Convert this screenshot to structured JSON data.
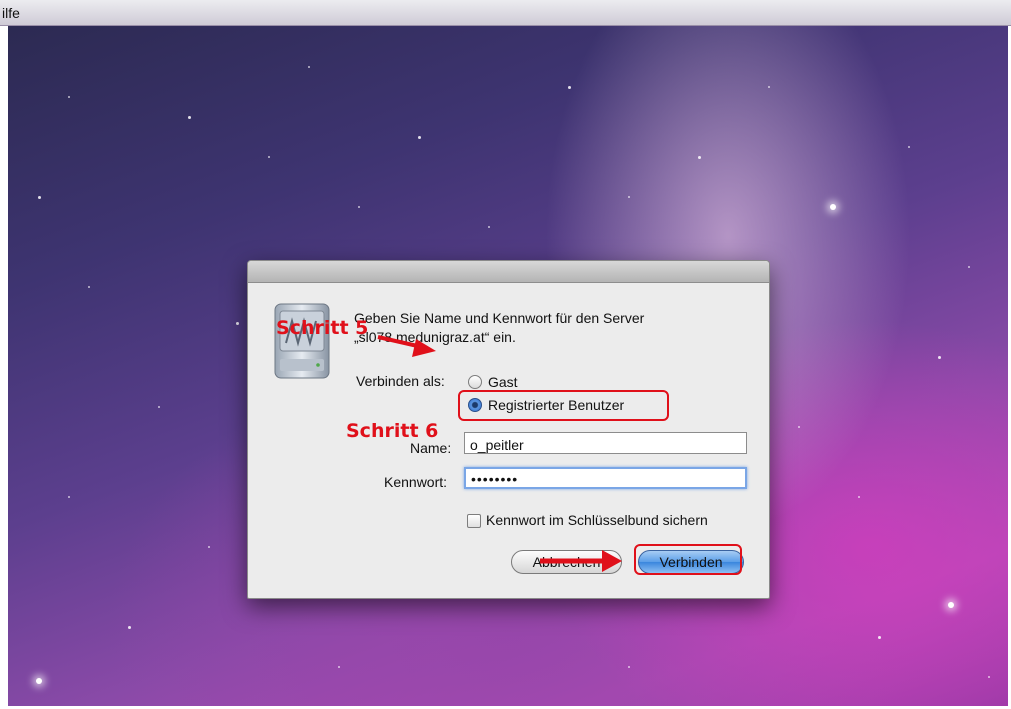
{
  "menubar": {
    "label": "ilfe"
  },
  "dialog": {
    "prompt_line1": "Geben Sie Name und Kennwort für den Server",
    "prompt_line2": "„sl078.medunigraz.at“ ein.",
    "connect_as_label": "Verbinden als:",
    "option_guest": "Gast",
    "option_registered": "Registrierter Benutzer",
    "selected_option": "Registrierter Benutzer",
    "name_label": "Name:",
    "name_value": "o_peitler",
    "password_label": "Kennwort:",
    "password_value": "••••••••",
    "keychain_label": "Kennwort im Schlüsselbund sichern",
    "keychain_checked": false,
    "cancel_label": "Abbrechen",
    "connect_label": "Verbinden"
  },
  "annotations": {
    "step5": "Schritt 5",
    "step6": "Schritt 6",
    "color": "#e0101a"
  }
}
